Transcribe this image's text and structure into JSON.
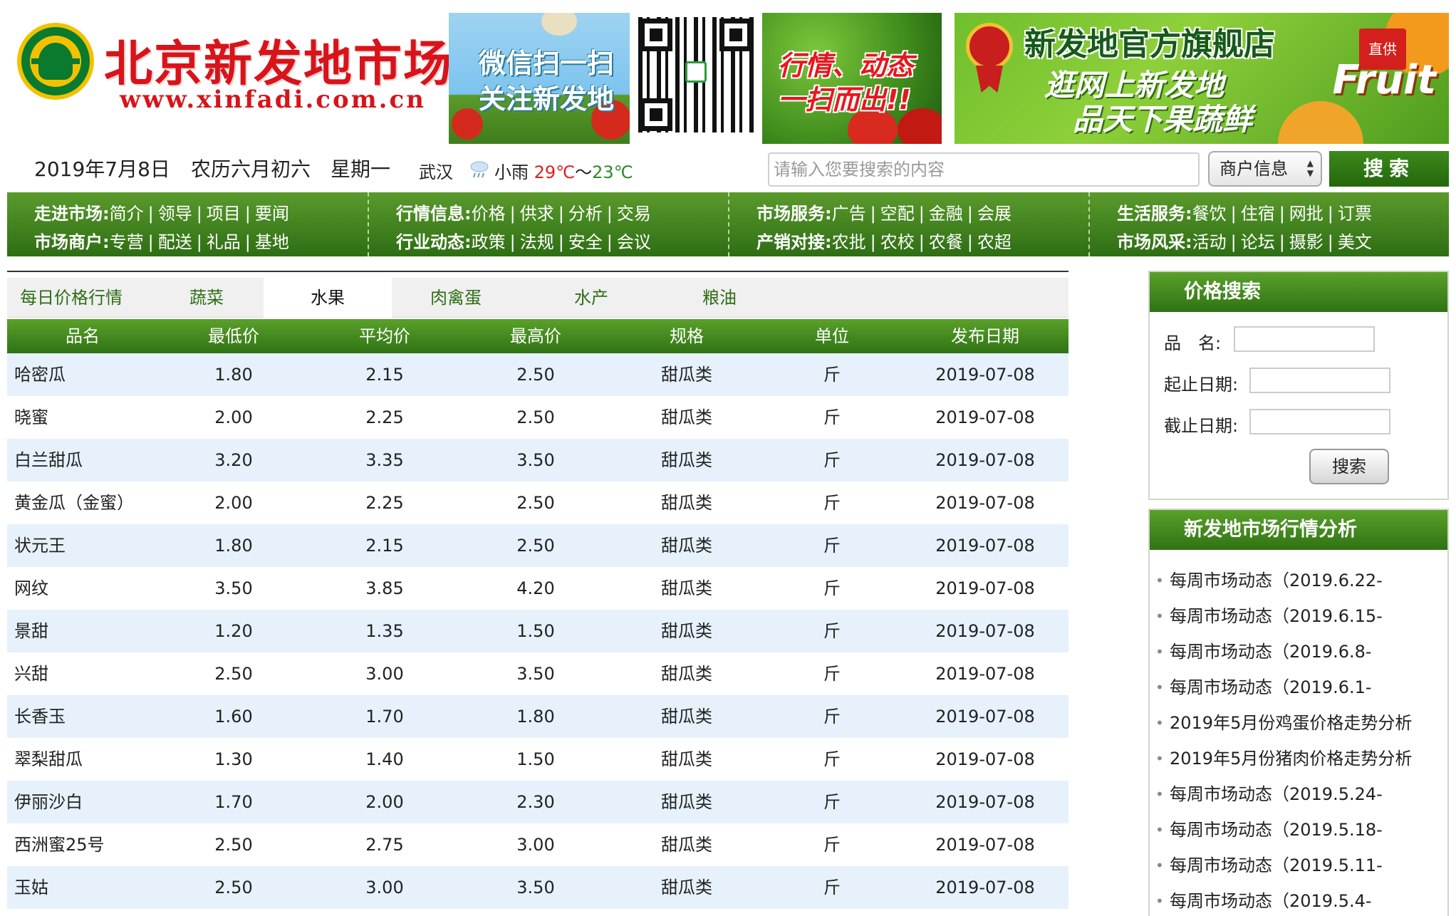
{
  "header": {
    "logo_title": "北京新发地市场",
    "logo_url": "www.xinfadi.com.cn",
    "banner_wechat_line1": "微信扫一扫",
    "banner_wechat_line2": "关注新发地",
    "banner_market_line1": "行情、动态",
    "banner_market_line2": "一扫而出!!",
    "banner_store_title": "新发地官方旗舰店",
    "banner_store_line1": "逛网上新发地",
    "banner_store_line2": "品天下果蔬鲜",
    "banner_store_badge": "直供",
    "banner_store_word": "Fruit"
  },
  "info": {
    "date": "2019年7月8日",
    "lunar": "农历六月初六",
    "weekday": "星期一",
    "city": "武汉",
    "weather": "小雨",
    "temp_high": "29℃",
    "temp_sep": "～",
    "temp_low": "23℃"
  },
  "search": {
    "placeholder": "请输入您要搜索的内容",
    "select_value": "商户信息",
    "button": "搜索"
  },
  "nav": {
    "columns": [
      {
        "line1_cat": "走进市场:",
        "line1_items": [
          "简介",
          "领导",
          "项目",
          "要闻"
        ],
        "line2_cat": "市场商户:",
        "line2_items": [
          "专营",
          "配送",
          "礼品",
          "基地"
        ]
      },
      {
        "line1_cat": "行情信息:",
        "line1_items": [
          "价格",
          "供求",
          "分析",
          "交易"
        ],
        "line2_cat": "行业动态:",
        "line2_items": [
          "政策",
          "法规",
          "安全",
          "会议"
        ]
      },
      {
        "line1_cat": "市场服务:",
        "line1_items": [
          "广告",
          "空配",
          "金融",
          "会展"
        ],
        "line2_cat": "产销对接:",
        "line2_items": [
          "农批",
          "农校",
          "农餐",
          "农超"
        ]
      },
      {
        "line1_cat": "生活服务:",
        "line1_items": [
          "餐饮",
          "住宿",
          "网批",
          "订票"
        ],
        "line2_cat": "市场风采:",
        "line2_items": [
          "活动",
          "论坛",
          "摄影",
          "美文"
        ]
      }
    ]
  },
  "tabs": [
    "每日价格行情",
    "蔬菜",
    "水果",
    "肉禽蛋",
    "水产",
    "粮油"
  ],
  "active_tab": 2,
  "table": {
    "headers": [
      "品名",
      "最低价",
      "平均价",
      "最高价",
      "规格",
      "单位",
      "发布日期"
    ],
    "rows": [
      [
        "哈密瓜",
        "1.80",
        "2.15",
        "2.50",
        "甜瓜类",
        "斤",
        "2019-07-08"
      ],
      [
        "晓蜜",
        "2.00",
        "2.25",
        "2.50",
        "甜瓜类",
        "斤",
        "2019-07-08"
      ],
      [
        "白兰甜瓜",
        "3.20",
        "3.35",
        "3.50",
        "甜瓜类",
        "斤",
        "2019-07-08"
      ],
      [
        "黄金瓜（金蜜）",
        "2.00",
        "2.25",
        "2.50",
        "甜瓜类",
        "斤",
        "2019-07-08"
      ],
      [
        "状元王",
        "1.80",
        "2.15",
        "2.50",
        "甜瓜类",
        "斤",
        "2019-07-08"
      ],
      [
        "网纹",
        "3.50",
        "3.85",
        "4.20",
        "甜瓜类",
        "斤",
        "2019-07-08"
      ],
      [
        "景甜",
        "1.20",
        "1.35",
        "1.50",
        "甜瓜类",
        "斤",
        "2019-07-08"
      ],
      [
        "兴甜",
        "2.50",
        "3.00",
        "3.50",
        "甜瓜类",
        "斤",
        "2019-07-08"
      ],
      [
        "长香玉",
        "1.60",
        "1.70",
        "1.80",
        "甜瓜类",
        "斤",
        "2019-07-08"
      ],
      [
        "翠梨甜瓜",
        "1.30",
        "1.40",
        "1.50",
        "甜瓜类",
        "斤",
        "2019-07-08"
      ],
      [
        "伊丽沙白",
        "1.70",
        "2.00",
        "2.30",
        "甜瓜类",
        "斤",
        "2019-07-08"
      ],
      [
        "西洲蜜25号",
        "2.50",
        "2.75",
        "3.00",
        "甜瓜类",
        "斤",
        "2019-07-08"
      ],
      [
        "玉姑",
        "2.50",
        "3.00",
        "3.50",
        "甜瓜类",
        "斤",
        "2019-07-08"
      ]
    ]
  },
  "price_search": {
    "title": "价格搜索",
    "name_label": "品　名:",
    "start_label": "起止日期:",
    "end_label": "截止日期:",
    "button": "搜索"
  },
  "analysis": {
    "title": "新发地市场行情分析",
    "items": [
      "每周市场动态（2019.6.22-",
      "每周市场动态（2019.6.15-",
      "每周市场动态（2019.6.8-",
      "每周市场动态（2019.6.1-",
      "2019年5月份鸡蛋价格走势分析",
      "2019年5月份猪肉价格走势分析",
      "每周市场动态（2019.5.24-",
      "每周市场动态（2019.5.18-",
      "每周市场动态（2019.5.11-",
      "每周市场动态（2019.5.4-"
    ]
  },
  "colors": {
    "brand_green": "#2f7314",
    "brand_red": "#d8141a",
    "row_alt": "#e6f1fb"
  }
}
